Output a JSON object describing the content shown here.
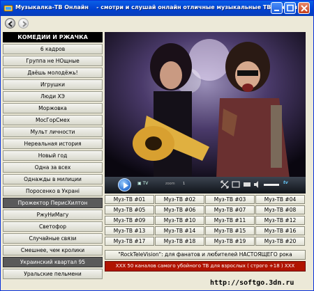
{
  "window": {
    "app_title": "Музыкалка-ТВ Онлайн",
    "tagline": "смотри и слушай онлайн отличные музыкальные ТВ каналы"
  },
  "sidebar": {
    "header": "КОМЕДИИ И РЖАЧКА",
    "items": [
      "6 кадров",
      "Группа не НОщные",
      "Даёшь молодёжь!",
      "Игрушки",
      "Люди ХЭ",
      "Моржовка",
      "МосГорСмех",
      "Мульт личности",
      "Нереальная история",
      "Новый год",
      "Одна за всех",
      "Однажды в милиции",
      "Поросенко в Украні",
      "Прожектор ПерисХилтон",
      "РжуНиМагу",
      "Светофор",
      "Случайные связи",
      "Смешнее, чем кролики",
      "Украинский квартал 95",
      "Уральские пельмени"
    ]
  },
  "player": {
    "tv_badge": "TV",
    "zoom_label": "zoom",
    "zoom_value": "1",
    "brand": "tv"
  },
  "channels": [
    [
      "Муз-ТВ #01",
      "Муз-ТВ #02",
      "Муз-ТВ #03",
      "Муз-ТВ #04"
    ],
    [
      "Муз-ТВ #05",
      "Муз-ТВ #06",
      "Муз-ТВ #07",
      "Муз-ТВ #08"
    ],
    [
      "Муз-ТВ #09",
      "Муз-ТВ #10",
      "Муз-ТВ #11",
      "Муз-ТВ #12"
    ],
    [
      "Муз-ТВ #13",
      "Муз-ТВ #14",
      "Муз-ТВ #15",
      "Муз-ТВ #16"
    ],
    [
      "Муз-ТВ #17",
      "Муз-ТВ #18",
      "Муз-ТВ #19",
      "Муз-ТВ #20"
    ]
  ],
  "banners": {
    "rock": "\"RockTeleVision\": для фанатов и любителей НАСТОЯЩЕГО рока",
    "xxx": "XXX 50 каналов самого убойного ТВ для взрослых ( строго +18 ) XXX"
  },
  "watermark": "http://softgo.3dn.ru",
  "colors": {
    "titlebar": "#0449d8",
    "sidebar_header": "#000000",
    "xxx_banner": "#b01400",
    "player_bar": "#10141a"
  }
}
